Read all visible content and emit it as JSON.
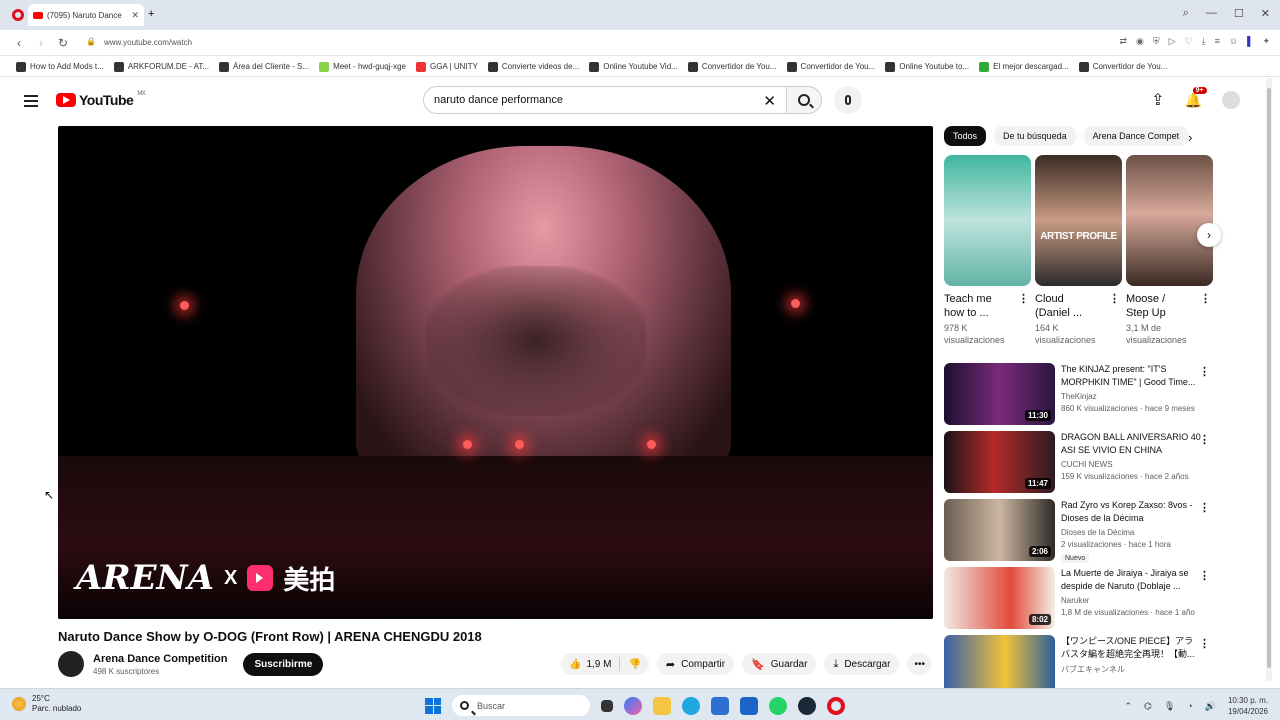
{
  "browser": {
    "tab_title": "(7095) Naruto Dance",
    "url": "www.youtube.com/watch",
    "bookmarks": [
      "How to Add Mods t...",
      "ARKFORUM.DE - AT...",
      "Área del Cliente - S...",
      "Meet - hwd-guqj-xge",
      "GGA | UNITY",
      "Convierte videos de...",
      "Online Youtube Vid...",
      "Convertidor de You...",
      "Convertidor de You...",
      "Online Youtube to...",
      "El mejor descargad...",
      "Convertidor de You..."
    ]
  },
  "header": {
    "logo_text": "YouTube",
    "logo_region": "MX",
    "search_value": "naruto dance performance",
    "notif_badge": "9+"
  },
  "video": {
    "title": "Naruto Dance Show by O-DOG (Front Row) | ARENA CHENGDU 2018",
    "watermark_arena": "ARENA",
    "watermark_x": "X",
    "watermark_cn": "美拍",
    "channel_name": "Arena Dance Competition",
    "channel_subs": "498 K suscriptores",
    "subscribe": "Suscribirme",
    "likes": "1,9 M",
    "share": "Compartir",
    "save": "Guardar",
    "download": "Descargar"
  },
  "chips": [
    "Todos",
    "De tu búsqueda",
    "Arena Dance Compet"
  ],
  "shorts": [
    {
      "title1": "Teach me",
      "title2": "how to ...",
      "views1": "978 K",
      "views2": "visualizaciones"
    },
    {
      "title1": "Cloud",
      "title2": "(Daniel ...",
      "views1": "164 K",
      "views2": "visualizaciones",
      "overlay": "ARTIST PROFILE"
    },
    {
      "title1": "Moose /",
      "title2": "Step Up",
      "views1": "3,1 M de",
      "views2": "visualizaciones"
    }
  ],
  "recommendations": [
    {
      "title": "The KINJAZ present: \"IT'S MORPHKIN TIME\" | Good Time...",
      "channel": "TheKinjaz",
      "meta": "860 K visualizaciones · hace 9 meses",
      "duration": "11:30"
    },
    {
      "title": "DRAGON BALL ANIVERSARIO 40 ASI SE VIVIO EN CHINA",
      "channel": "CUCHI NEWS",
      "meta": "159 K visualizaciones · hace 2 años",
      "duration": "11:47"
    },
    {
      "title": "Rad Zyro vs Korep Zaxso: 8vos - Dioses de la Décima",
      "channel": "Dioses de la Décima",
      "meta": "2 visualizaciones · hace 1 hora",
      "duration": "2:06",
      "badge": "Nuevo"
    },
    {
      "title": "La Muerte de Jiraiya - Jiraiya se despide de Naruto (Doblaje ...",
      "channel": "Naruker",
      "meta": "1,8 M de visualizaciones · hace 1 año",
      "duration": "8:02"
    },
    {
      "title": "【ワンピース/ONE PIECE】アラバスタ編を超絶完全再現！【動...",
      "channel": "パブエキャンネル",
      "meta": "",
      "duration": ""
    }
  ],
  "taskbar": {
    "temp": "25°C",
    "weather": "Parc. nublado",
    "search": "Buscar",
    "time": "10:30 p. m.",
    "date": "19/04/2026"
  },
  "colors": {
    "accent": "#ff0000",
    "subscribe_bg": "#0f0f0f",
    "badge": "#cc0000"
  }
}
